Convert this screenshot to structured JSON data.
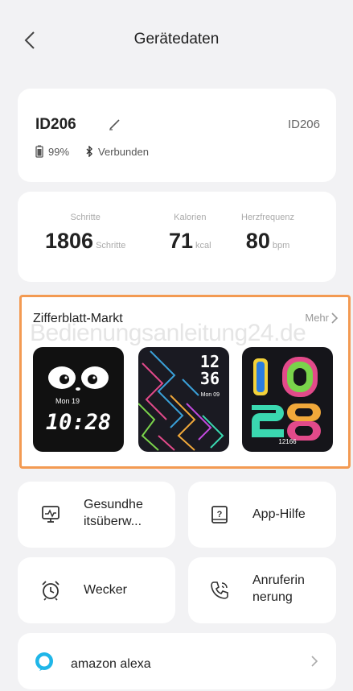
{
  "header": {
    "title": "Gerätedaten"
  },
  "device": {
    "name": "ID206",
    "id_right": "ID206",
    "battery": "99%",
    "connection": "Verbunden"
  },
  "stats": [
    {
      "label": "Schritte",
      "value": "1806",
      "unit": "Schritte"
    },
    {
      "label": "Kalorien",
      "value": "71",
      "unit": "kcal"
    },
    {
      "label": "Herzfrequenz",
      "value": "80",
      "unit": "bpm"
    }
  ],
  "market": {
    "title": "Zifferblatt-Markt",
    "more": "Mehr",
    "watermark": "Bedienungsanleitung24.de",
    "faces": [
      {
        "date": "Mon 19",
        "time": "10:28"
      },
      {
        "hour": "12",
        "minute": "36",
        "date": "Mon 09"
      },
      {
        "steps": "12166"
      }
    ]
  },
  "tiles": {
    "health_line1": "Gesundhe",
    "health_line2": "itsüberw...",
    "help": "App-Hilfe",
    "alarm": "Wecker",
    "call_line1": "Anruferin",
    "call_line2": "nerung"
  },
  "alexa": {
    "label": "amazon alexa"
  },
  "colors": {
    "accent_border": "#f39a52",
    "alexa_blue": "#1fb6e8"
  }
}
